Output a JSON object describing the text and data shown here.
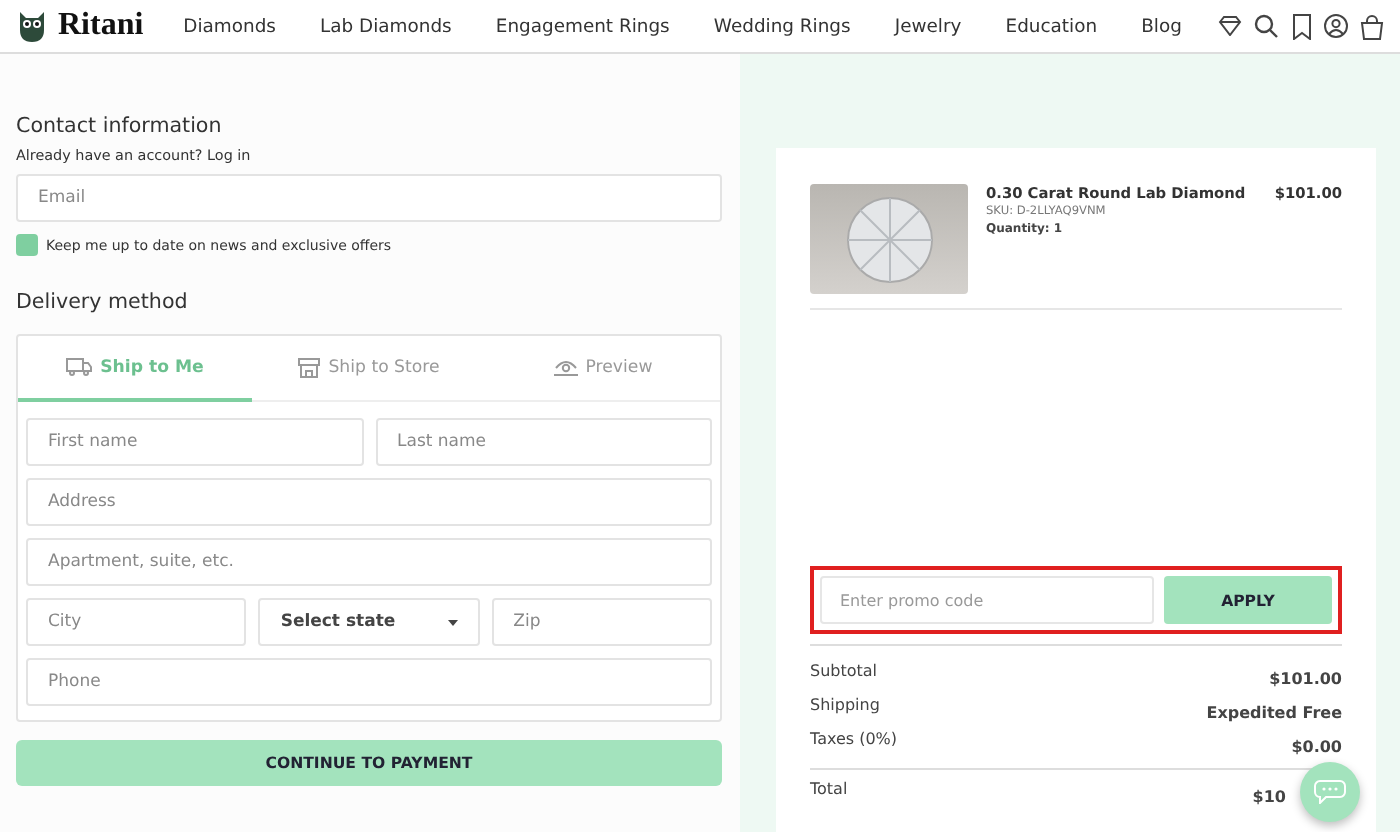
{
  "header": {
    "logo": "Ritani",
    "nav": [
      {
        "label": "Diamonds"
      },
      {
        "label": "Lab Diamonds"
      },
      {
        "label": "Engagement Rings"
      },
      {
        "label": "Wedding Rings"
      },
      {
        "label": "Jewelry"
      },
      {
        "label": "Education"
      },
      {
        "label": "Blog"
      }
    ]
  },
  "contact": {
    "title": "Contact information",
    "account_prompt": "Already have an account?",
    "login_link": "Log in",
    "email": {
      "placeholder": "Email"
    },
    "newsletter": {
      "label": "Keep me up to date on news and exclusive offers",
      "checked": true
    }
  },
  "delivery": {
    "title": "Delivery method",
    "tabs": [
      {
        "label": "Ship to Me",
        "selected": true
      },
      {
        "label": "Ship to Store",
        "selected": false
      },
      {
        "label": "Preview",
        "selected": false
      }
    ],
    "fields": [
      [
        {
          "placeholder": "First name",
          "kind": "text"
        },
        {
          "placeholder": "Last name",
          "kind": "text"
        }
      ],
      [
        {
          "placeholder": "Address",
          "kind": "text"
        }
      ],
      [
        {
          "placeholder": "Apartment, suite, etc.",
          "kind": "text"
        }
      ],
      [
        {
          "placeholder": "City",
          "kind": "text"
        },
        {
          "value": "Select state",
          "kind": "select"
        },
        {
          "placeholder": "Zip",
          "kind": "text"
        }
      ],
      [
        {
          "placeholder": "Phone",
          "kind": "text"
        }
      ]
    ],
    "continue_button": "CONTINUE TO PAYMENT"
  },
  "summary": {
    "item": {
      "name": "0.30 Carat Round Lab Diamond",
      "sku": "SKU: D-2LLYAQ9VNM",
      "quantity": "Quantity: 1",
      "price": "$101.00"
    },
    "promo": {
      "placeholder": "Enter promo code",
      "button": "APPLY",
      "highlighted": true
    },
    "lines": [
      {
        "label": "Subtotal",
        "value": "$101.00"
      },
      {
        "label": "Shipping",
        "value": "Expedited Free"
      },
      {
        "label": "Taxes (0%)",
        "value": "$0.00"
      }
    ],
    "total": {
      "label": "Total",
      "value": "$10"
    }
  }
}
